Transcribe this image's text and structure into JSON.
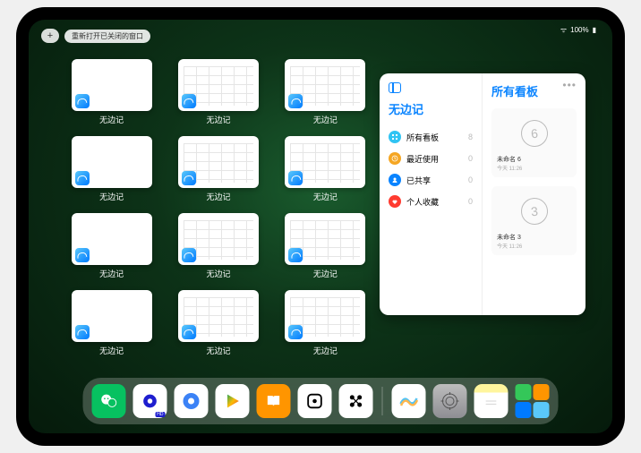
{
  "status": {
    "signal": "•••",
    "wifi": "⌃",
    "battery_pct": "100%"
  },
  "toolbar": {
    "plus": "+",
    "reopen_label": "重新打开已关闭的窗口"
  },
  "app_windows": {
    "label": "无边记",
    "tiles": [
      {
        "style": "blank"
      },
      {
        "style": "grid"
      },
      {
        "style": "grid"
      },
      {
        "style": "blank"
      },
      {
        "style": "grid"
      },
      {
        "style": "grid"
      },
      {
        "style": "blank"
      },
      {
        "style": "grid"
      },
      {
        "style": "grid"
      },
      {
        "style": "blank"
      },
      {
        "style": "grid"
      },
      {
        "style": "grid"
      }
    ]
  },
  "panel": {
    "left_title": "无边记",
    "items": [
      {
        "icon": "grid",
        "color": "#31c4f3",
        "label": "所有看板",
        "count": "8"
      },
      {
        "icon": "clock",
        "color": "#f5a623",
        "label": "最近使用",
        "count": "0"
      },
      {
        "icon": "people",
        "color": "#0a84ff",
        "label": "已共享",
        "count": "0"
      },
      {
        "icon": "heart",
        "color": "#ff3b30",
        "label": "个人收藏",
        "count": "0"
      }
    ],
    "right_title": "所有看板",
    "boards": [
      {
        "digit": "6",
        "name": "未命名 6",
        "time": "今天 11:26"
      },
      {
        "digit": "3",
        "name": "未命名 3",
        "time": "今天 11:26"
      }
    ]
  },
  "dock": {
    "apps": [
      {
        "name": "wechat",
        "bg": "#07c160"
      },
      {
        "name": "quark-hd",
        "bg": "#ffffff"
      },
      {
        "name": "quark",
        "bg": "#4285f4"
      },
      {
        "name": "play",
        "bg": "#ffffff"
      },
      {
        "name": "books",
        "bg": "#ff9500"
      },
      {
        "name": "dice",
        "bg": "#ffffff"
      },
      {
        "name": "connect",
        "bg": "#ffffff"
      },
      {
        "name": "freeform",
        "bg": "#ffffff"
      },
      {
        "name": "settings",
        "bg": "#8e8e93"
      },
      {
        "name": "notes",
        "bg": "#ffffff"
      }
    ]
  }
}
